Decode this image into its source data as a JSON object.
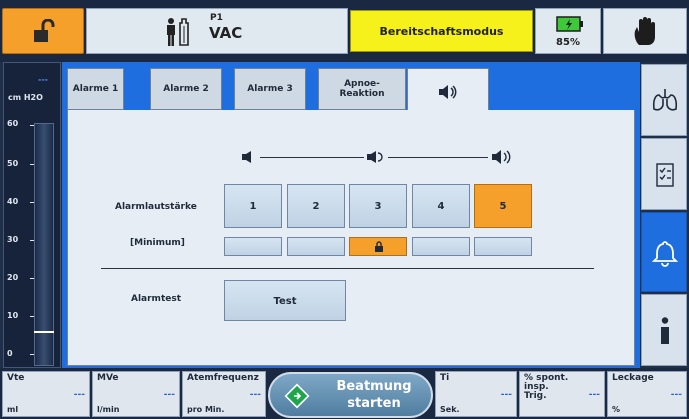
{
  "topbar": {
    "patient_label": "P1",
    "mode": "VAC",
    "status": "Bereitschaftsmodus",
    "battery": "85%",
    "icons": [
      "unlock-icon",
      "patient-icon",
      "battery-icon",
      "hand-icon"
    ]
  },
  "pressure_scale": {
    "value": "---",
    "unit": "cm H2O",
    "ticks": [
      "60",
      "50",
      "40",
      "30",
      "20",
      "10",
      "0"
    ],
    "level_fraction": 0.12
  },
  "tabs": [
    "Alarme 1",
    "Alarme 2",
    "Alarme 3",
    "Apnoe-\nReaktion",
    ""
  ],
  "alarm": {
    "volume_label": "Alarmlautstärke",
    "levels": [
      "1",
      "2",
      "3",
      "4",
      "5"
    ],
    "selected_level": "5",
    "minimum_label": "[Minimum]",
    "minimum_selected": 3,
    "test_label": "Alarmtest",
    "test_button": "Test"
  },
  "side": [
    "lungs-icon",
    "checklist-icon",
    "bell-icon",
    "info-icon"
  ],
  "bottom": {
    "measurements": [
      {
        "name": "Vte",
        "unit": "ml",
        "value": "---"
      },
      {
        "name": "MVe",
        "unit": "l/min",
        "value": "---"
      },
      {
        "name": "Atemfrequenz",
        "unit": "pro Min.",
        "value": "---"
      },
      {
        "name": "Ti",
        "unit": "Sek.",
        "value": "---"
      },
      {
        "name": "% spont.\ninsp.\nTrig.",
        "unit": "",
        "value": "---"
      },
      {
        "name": "Leckage",
        "unit": "%",
        "value": "---"
      }
    ],
    "start_button": "Beatmung\nstarten"
  },
  "colors": {
    "accent": "#1f6ee0",
    "warning": "#f5a02a",
    "standby": "#f6f01b"
  }
}
